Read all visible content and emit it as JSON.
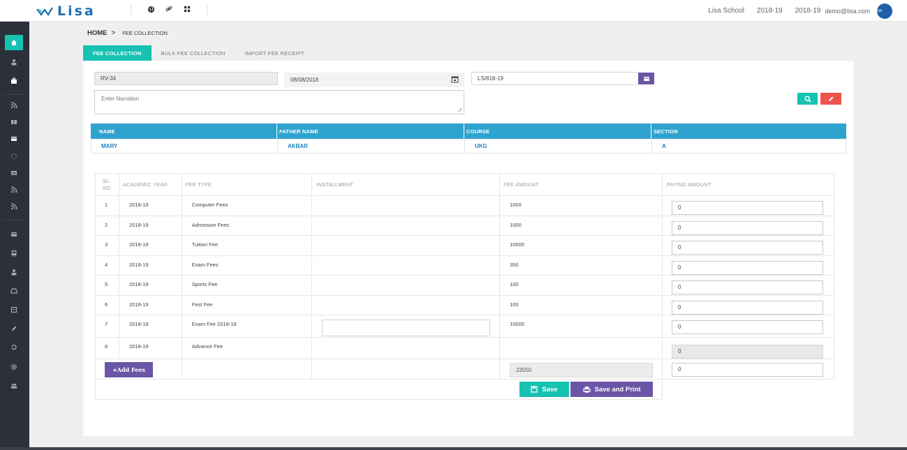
{
  "header": {
    "logo_text": "Lisa",
    "school": "Lisa School",
    "year1": "2018-19",
    "year2": "2018-19",
    "user_email": "demo@lisa.com",
    "avatar_text": "LISA",
    "icons": [
      "globe-icon",
      "link-icon",
      "grid-icon"
    ]
  },
  "sidebar": {
    "items": [
      "home-icon",
      "user-icon",
      "briefcase-icon",
      "rss-icon",
      "columns-icon",
      "card-icon",
      "spinner-icon",
      "list-icon",
      "rss-icon",
      "rss-icon",
      "card-icon",
      "bus-icon",
      "user-icon",
      "inbox-icon",
      "book-icon",
      "pencil-icon",
      "history-icon",
      "gear-icon",
      "users-icon"
    ],
    "active_color": "#16c2b2"
  },
  "breadcrumb": {
    "home": "HOME",
    "separator": ">",
    "current": "FEE COLLECTION"
  },
  "tabs": [
    {
      "label": "FEE COLLECTION",
      "active": true
    },
    {
      "label": "BULK FEE COLLECTION",
      "active": false
    },
    {
      "label": "IMPORT FEE RECEIPT",
      "active": false
    }
  ],
  "form": {
    "receipt_no": "RV-34",
    "date": "08/08/2018",
    "admission_no": "LS/818-19",
    "narration_placeholder": "Enter Narration"
  },
  "student": {
    "headers": [
      "NAME",
      "FATHER NAME",
      "COURSE",
      "SECTION"
    ],
    "values": [
      "MARY",
      "AKBAR",
      "UKG",
      "A"
    ]
  },
  "fees": {
    "headers": [
      "SL. NO",
      "ACADEMIC YEAR",
      "FEE TYPE",
      "INSTALLMENT",
      "FEE AMOUNT",
      "PAYING AMOUNT"
    ],
    "rows": [
      {
        "sl": "1",
        "year": "2018-19",
        "type": "Computer Fees",
        "amount": "1000",
        "paying": "0"
      },
      {
        "sl": "2",
        "year": "2018-19",
        "type": "Admission Fees",
        "amount": "1000",
        "paying": "0"
      },
      {
        "sl": "3",
        "year": "2018-19",
        "type": "Tuition Fee",
        "amount": "10500",
        "paying": "0"
      },
      {
        "sl": "4",
        "year": "2018-19",
        "type": "Exam Fees",
        "amount": "350",
        "paying": "0"
      },
      {
        "sl": "5",
        "year": "2018-19",
        "type": "Sports Fee",
        "amount": "100",
        "paying": "0"
      },
      {
        "sl": "6",
        "year": "2018-19",
        "type": "Fest Fee",
        "amount": "100",
        "paying": "0"
      },
      {
        "sl": "7",
        "year": "2018-19",
        "type": "Exam Fee 2018-19",
        "amount": "10000",
        "paying": "0"
      },
      {
        "sl": "8",
        "year": "2018-19",
        "type": "Advance Fee",
        "amount": "",
        "paying": "0"
      }
    ],
    "add_fees_label": "+Add Fees",
    "total_amount": "23050",
    "total_paying": "0"
  },
  "actions": {
    "save": "Save",
    "save_print": "Save and Print"
  },
  "colors": {
    "teal": "#16c2b2",
    "purple": "#6b55a6",
    "blue_header": "#2fa3cf",
    "red": "#ef5350",
    "sidebar": "#2c3038"
  }
}
